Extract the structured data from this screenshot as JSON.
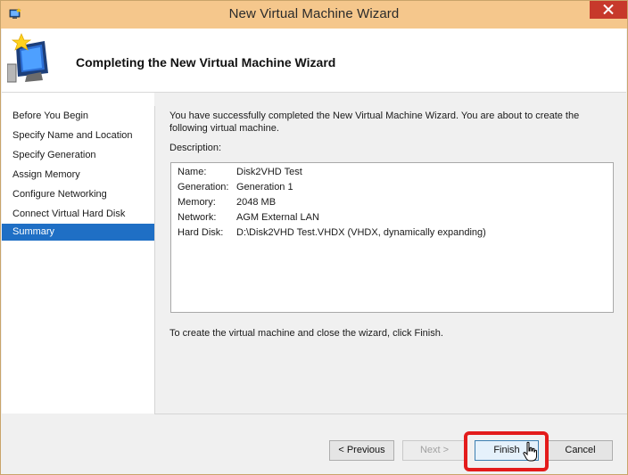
{
  "window": {
    "title": "New Virtual Machine Wizard",
    "icon": "hyper-v-window-icon"
  },
  "header": {
    "title": "Completing the New Virtual Machine Wizard",
    "icon": "new-vm-wizard-icon"
  },
  "nav": {
    "items": [
      {
        "label": "Before You Begin",
        "active": false
      },
      {
        "label": "Specify Name and Location",
        "active": false
      },
      {
        "label": "Specify Generation",
        "active": false
      },
      {
        "label": "Assign Memory",
        "active": false
      },
      {
        "label": "Configure Networking",
        "active": false
      },
      {
        "label": "Connect Virtual Hard Disk",
        "active": false
      },
      {
        "label": "Summary",
        "active": true
      }
    ]
  },
  "content": {
    "intro_line1": "You have successfully completed the New Virtual Machine Wizard. You are about to create the",
    "intro_line2": "following virtual machine.",
    "description_label": "Description:",
    "summary": [
      {
        "key": "Name:",
        "value": "Disk2VHD Test"
      },
      {
        "key": "Generation:",
        "value": "Generation 1"
      },
      {
        "key": "Memory:",
        "value": "2048 MB"
      },
      {
        "key": "Network:",
        "value": "AGM External LAN"
      },
      {
        "key": "Hard Disk:",
        "value": "D:\\Disk2VHD Test.VHDX (VHDX, dynamically expanding)"
      }
    ],
    "finish_hint": "To create the virtual machine and close the wizard, click Finish."
  },
  "buttons": {
    "previous": "< Previous",
    "next": "Next >",
    "finish": "Finish",
    "cancel": "Cancel"
  },
  "colors": {
    "titlebar": "#f5c78c",
    "nav_active": "#1f6fc5",
    "close": "#c7392b",
    "highlight": "#e31b1b"
  }
}
